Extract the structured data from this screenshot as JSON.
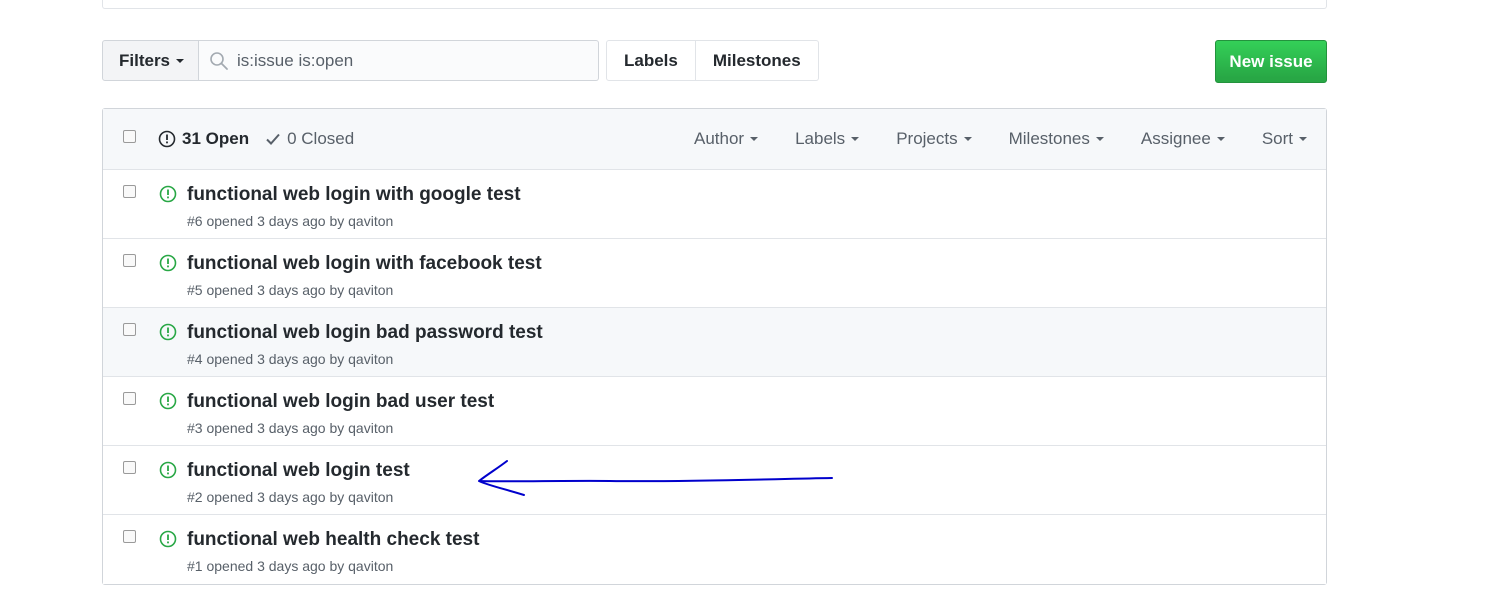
{
  "toolbar": {
    "filters_label": "Filters",
    "search_value": "is:issue is:open",
    "labels_label": "Labels",
    "milestones_label": "Milestones",
    "new_issue_label": "New issue"
  },
  "header": {
    "open_label": "31 Open",
    "closed_label": "0 Closed",
    "filters": [
      "Author",
      "Labels",
      "Projects",
      "Milestones",
      "Assignee",
      "Sort"
    ]
  },
  "issues": [
    {
      "title": "functional web login with google test",
      "number": "#6",
      "opened": "opened 3 days ago by",
      "author": "qaviton"
    },
    {
      "title": "functional web login with facebook test",
      "number": "#5",
      "opened": "opened 3 days ago by",
      "author": "qaviton"
    },
    {
      "title": "functional web login bad password test",
      "number": "#4",
      "opened": "opened 3 days ago by",
      "author": "qaviton"
    },
    {
      "title": "functional web login bad user test",
      "number": "#3",
      "opened": "opened 3 days ago by",
      "author": "qaviton"
    },
    {
      "title": "functional web login test",
      "number": "#2",
      "opened": "opened 3 days ago by",
      "author": "qaviton"
    },
    {
      "title": "functional web health check test",
      "number": "#1",
      "opened": "opened 3 days ago by",
      "author": "qaviton"
    }
  ],
  "icons": {
    "search": "search-icon",
    "issue_open": "issue-opened-icon",
    "check": "check-icon",
    "caret": "caret-down-icon"
  },
  "colors": {
    "open_issue_green": "#28a745",
    "new_issue_button": "#2cbe4e",
    "annotation_arrow": "#0000cc",
    "hovered_row": "#f6f8fa"
  }
}
